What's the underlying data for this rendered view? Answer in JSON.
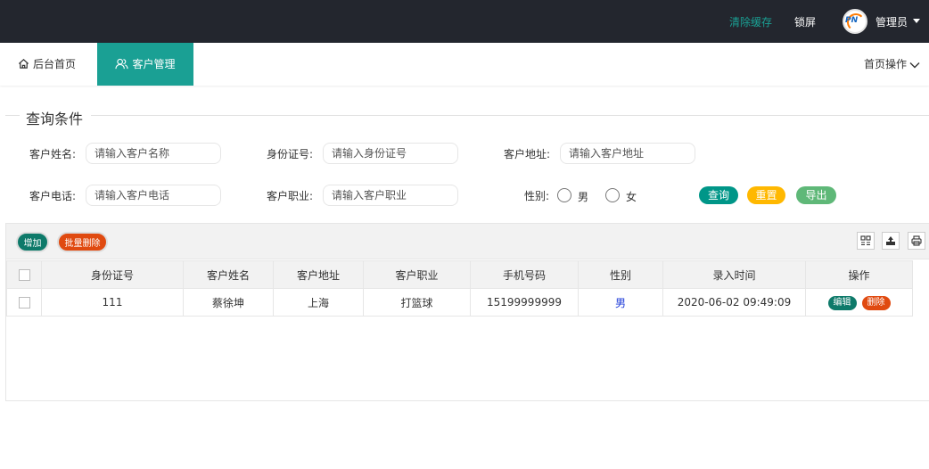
{
  "header": {
    "clear_cache": "清除缓存",
    "lock_screen": "锁屏",
    "avatar_text": "PN",
    "admin": "管理员"
  },
  "tabs": {
    "home": "后台首页",
    "customer": "客户管理",
    "home_actions": "首页操作"
  },
  "search": {
    "legend": "查询条件",
    "name_label": "客户姓名:",
    "name_placeholder": "请输入客户名称",
    "id_label": "身份证号:",
    "id_placeholder": "请输入身份证号",
    "address_label": "客户地址:",
    "address_placeholder": "请输入客户地址",
    "phone_label": "客户电话:",
    "phone_placeholder": "请输入客户电话",
    "job_label": "客户职业:",
    "job_placeholder": "请输入客户职业",
    "gender_label": "性别:",
    "male": "男",
    "female": "女",
    "query": "查询",
    "reset": "重置",
    "export": "导出"
  },
  "toolbar": {
    "add": "增加",
    "batch_delete": "批量删除"
  },
  "table": {
    "columns": [
      "身份证号",
      "客户姓名",
      "客户地址",
      "客户职业",
      "手机号码",
      "性别",
      "录入时间",
      "操作"
    ],
    "rows": [
      {
        "id_card": "111",
        "name": "蔡徐坤",
        "address": "上海",
        "job": "打篮球",
        "phone": "15199999999",
        "gender": "男",
        "created": "2020-06-02 09:49:09",
        "edit": "编辑",
        "delete": "删除"
      }
    ]
  },
  "colors": {
    "topbar_bg": "#23262e",
    "accent": "#1aa094",
    "query_btn": "#009688",
    "reset_btn": "#ffb800",
    "export_btn": "#5fb878",
    "danger_btn": "#e04a10",
    "add_btn": "#0e7a6a"
  }
}
